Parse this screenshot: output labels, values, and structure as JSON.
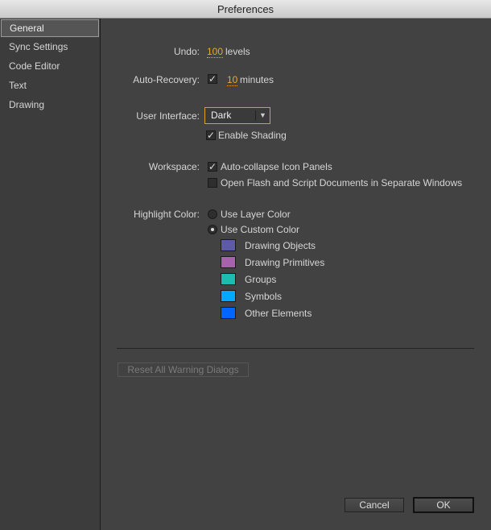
{
  "window": {
    "title": "Preferences"
  },
  "sidebar": {
    "items": [
      {
        "label": "General",
        "selected": true
      },
      {
        "label": "Sync Settings"
      },
      {
        "label": "Code Editor"
      },
      {
        "label": "Text"
      },
      {
        "label": "Drawing"
      }
    ]
  },
  "general": {
    "undo": {
      "label": "Undo:",
      "value": "100",
      "unit": "levels"
    },
    "auto_recovery": {
      "label": "Auto-Recovery:",
      "checked": true,
      "value": "10",
      "unit": "minutes"
    },
    "user_interface": {
      "label": "User Interface:",
      "selected": "Dark",
      "enable_shading": {
        "label": "Enable Shading",
        "checked": true
      }
    },
    "workspace": {
      "label": "Workspace:",
      "options": [
        {
          "label": "Auto-collapse Icon Panels",
          "checked": true
        },
        {
          "label": "Open Flash and Script Documents in Separate Windows",
          "checked": false
        }
      ]
    },
    "highlight": {
      "label": "Highlight Color:",
      "options": [
        {
          "label": "Use Layer Color",
          "selected": false
        },
        {
          "label": "Use Custom Color",
          "selected": true
        }
      ],
      "swatches": [
        {
          "label": "Drawing Objects",
          "color": "#5f5aa8"
        },
        {
          "label": "Drawing Primitives",
          "color": "#a862ad"
        },
        {
          "label": "Groups",
          "color": "#1dbcb1"
        },
        {
          "label": "Symbols",
          "color": "#00a8ff"
        },
        {
          "label": "Other Elements",
          "color": "#0066ff"
        }
      ]
    },
    "reset_label": "Reset All Warning Dialogs"
  },
  "footer": {
    "cancel": "Cancel",
    "ok": "OK"
  }
}
